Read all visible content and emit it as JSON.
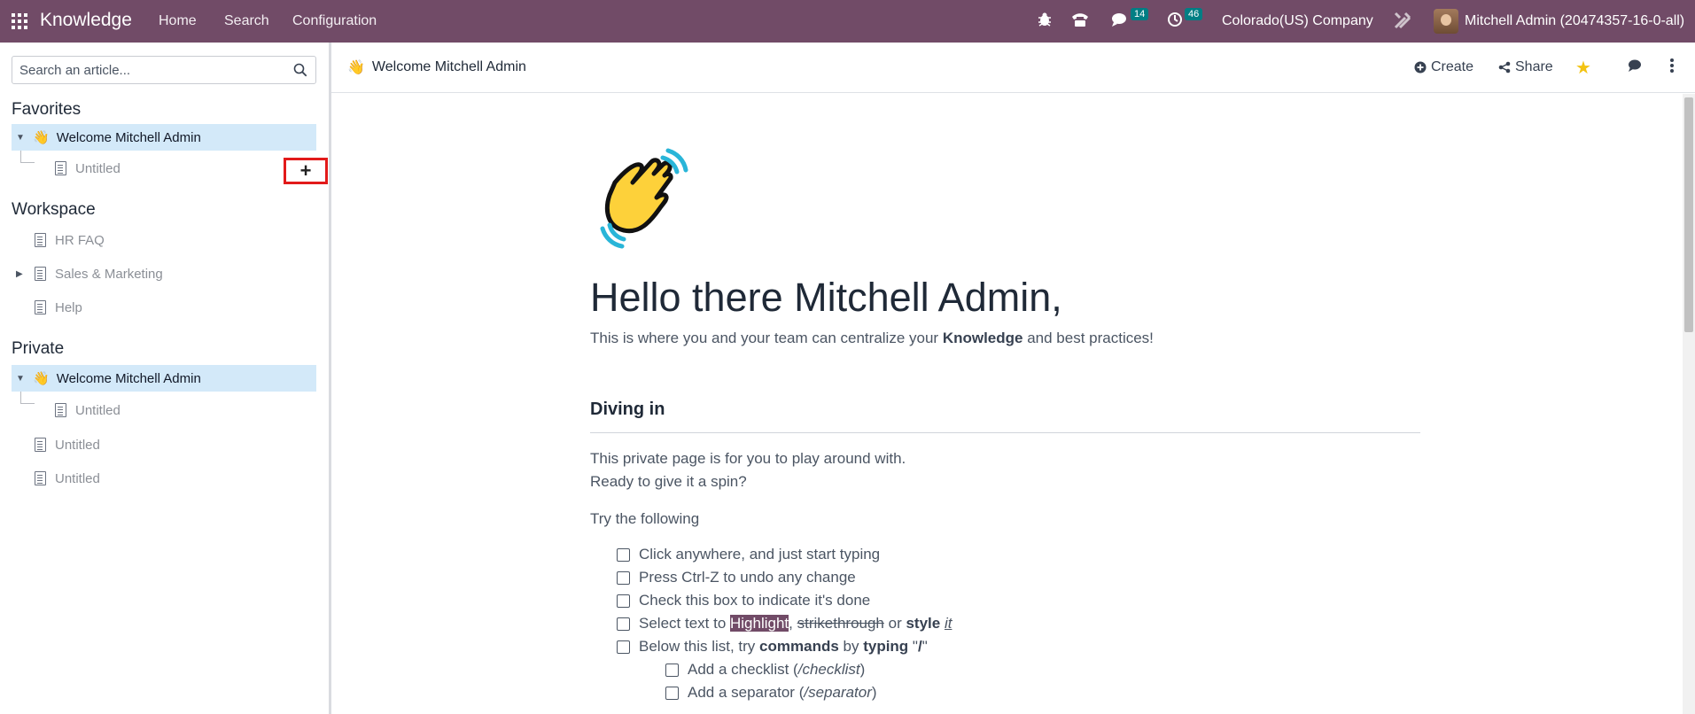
{
  "navbar": {
    "app_name": "Knowledge",
    "menu": [
      "Home",
      "Search",
      "Configuration"
    ],
    "messages_count": "14",
    "activities_count": "46",
    "company": "Colorado(US) Company",
    "user": "Mitchell Admin (20474357-16-0-all)",
    "colors": {
      "bar": "#714B67",
      "badge": "#017E84"
    }
  },
  "sidebar": {
    "search_placeholder": "Search an article...",
    "favorites": {
      "title": "Favorites",
      "items": [
        {
          "label": "Welcome Mitchell Admin",
          "icon": "waving-hand-icon",
          "expanded": true,
          "active": true
        },
        {
          "label": "Untitled",
          "icon": "document-icon",
          "child": true
        }
      ]
    },
    "workspace": {
      "title": "Workspace",
      "add_label": "+",
      "items": [
        {
          "label": "HR FAQ",
          "icon": "document-icon"
        },
        {
          "label": "Sales & Marketing",
          "icon": "document-icon",
          "collapsed": true
        },
        {
          "label": "Help",
          "icon": "document-icon"
        }
      ]
    },
    "private": {
      "title": "Private",
      "items": [
        {
          "label": "Welcome Mitchell Admin",
          "icon": "waving-hand-icon",
          "expanded": true,
          "active": true
        },
        {
          "label": "Untitled",
          "icon": "document-icon",
          "child": true
        },
        {
          "label": "Untitled",
          "icon": "document-icon"
        },
        {
          "label": "Untitled",
          "icon": "document-icon"
        }
      ]
    }
  },
  "header": {
    "title": "Welcome Mitchell Admin",
    "create_label": "Create",
    "share_label": "Share"
  },
  "article": {
    "heading": "Hello there Mitchell Admin,",
    "intro_prefix": "This is where you and your team can centralize your ",
    "intro_bold": "Knowledge",
    "intro_suffix": " and best practices!",
    "section_title": "Diving in",
    "para1": "This private page is for you to play around with.",
    "para2": "Ready to give it a spin?",
    "para3": "Try the following",
    "checklist": {
      "item1": "Click anywhere, and just start typing",
      "item2": "Press Ctrl-Z to undo any change",
      "item3": "Check this box to indicate it's done",
      "item4": {
        "prefix": "Select text to ",
        "highlight": "Highlight",
        "comma": ", ",
        "strike": "strikethrough",
        "or": " or ",
        "style": "style",
        "space": " ",
        "it": "it"
      },
      "item5": {
        "prefix": "Below this list, try ",
        "commands": "commands",
        "by": " by ",
        "typing": "typing",
        "quote_open": " \"",
        "slash": "/",
        "quote_close": "\""
      },
      "sub1": {
        "text": "Add a checklist (",
        "cmd": "/checklist",
        "close": ")"
      },
      "sub2": {
        "text": "Add a separator (",
        "cmd": "/separator",
        "close": ")"
      }
    }
  }
}
